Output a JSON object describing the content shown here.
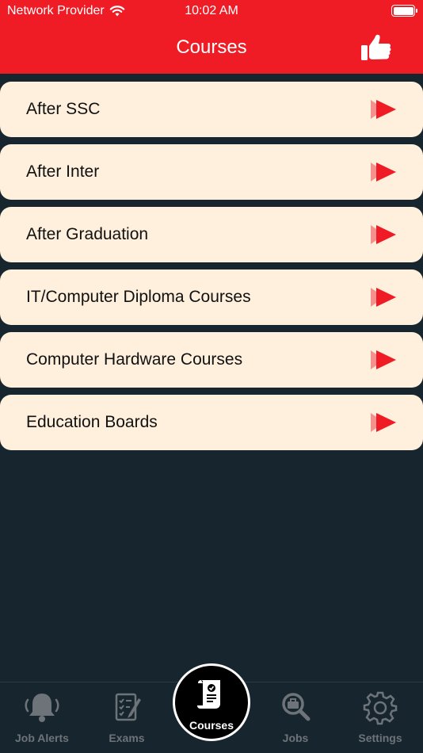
{
  "status_bar": {
    "carrier": "Network Provider",
    "time": "10:02 AM",
    "battery_level": 1.0
  },
  "header": {
    "title": "Courses",
    "like_icon": "thumbs-up-icon",
    "background_color": "#ef1c25"
  },
  "courses": [
    {
      "label": "After SSC",
      "icon": "play-arrow-icon"
    },
    {
      "label": "After Inter",
      "icon": "play-arrow-icon"
    },
    {
      "label": "After Graduation",
      "icon": "play-arrow-icon"
    },
    {
      "label": "IT/Computer Diploma Courses",
      "icon": "play-arrow-icon"
    },
    {
      "label": "Computer Hardware Courses",
      "icon": "play-arrow-icon"
    },
    {
      "label": "Education Boards",
      "icon": "play-arrow-icon"
    }
  ],
  "tabs": [
    {
      "label": "Job Alerts",
      "icon": "bell-icon",
      "selected": false
    },
    {
      "label": "Exams",
      "icon": "exam-sheet-icon",
      "selected": false
    },
    {
      "label": "Courses",
      "icon": "certificate-scroll-icon",
      "selected": true
    },
    {
      "label": "Jobs",
      "icon": "job-search-icon",
      "selected": false
    },
    {
      "label": "Settings",
      "icon": "gear-icon",
      "selected": false
    }
  ],
  "colors": {
    "background": "#17262e",
    "card": "#fff0dd",
    "accent": "#ef1c25",
    "tab_inactive": "#6d7378"
  }
}
